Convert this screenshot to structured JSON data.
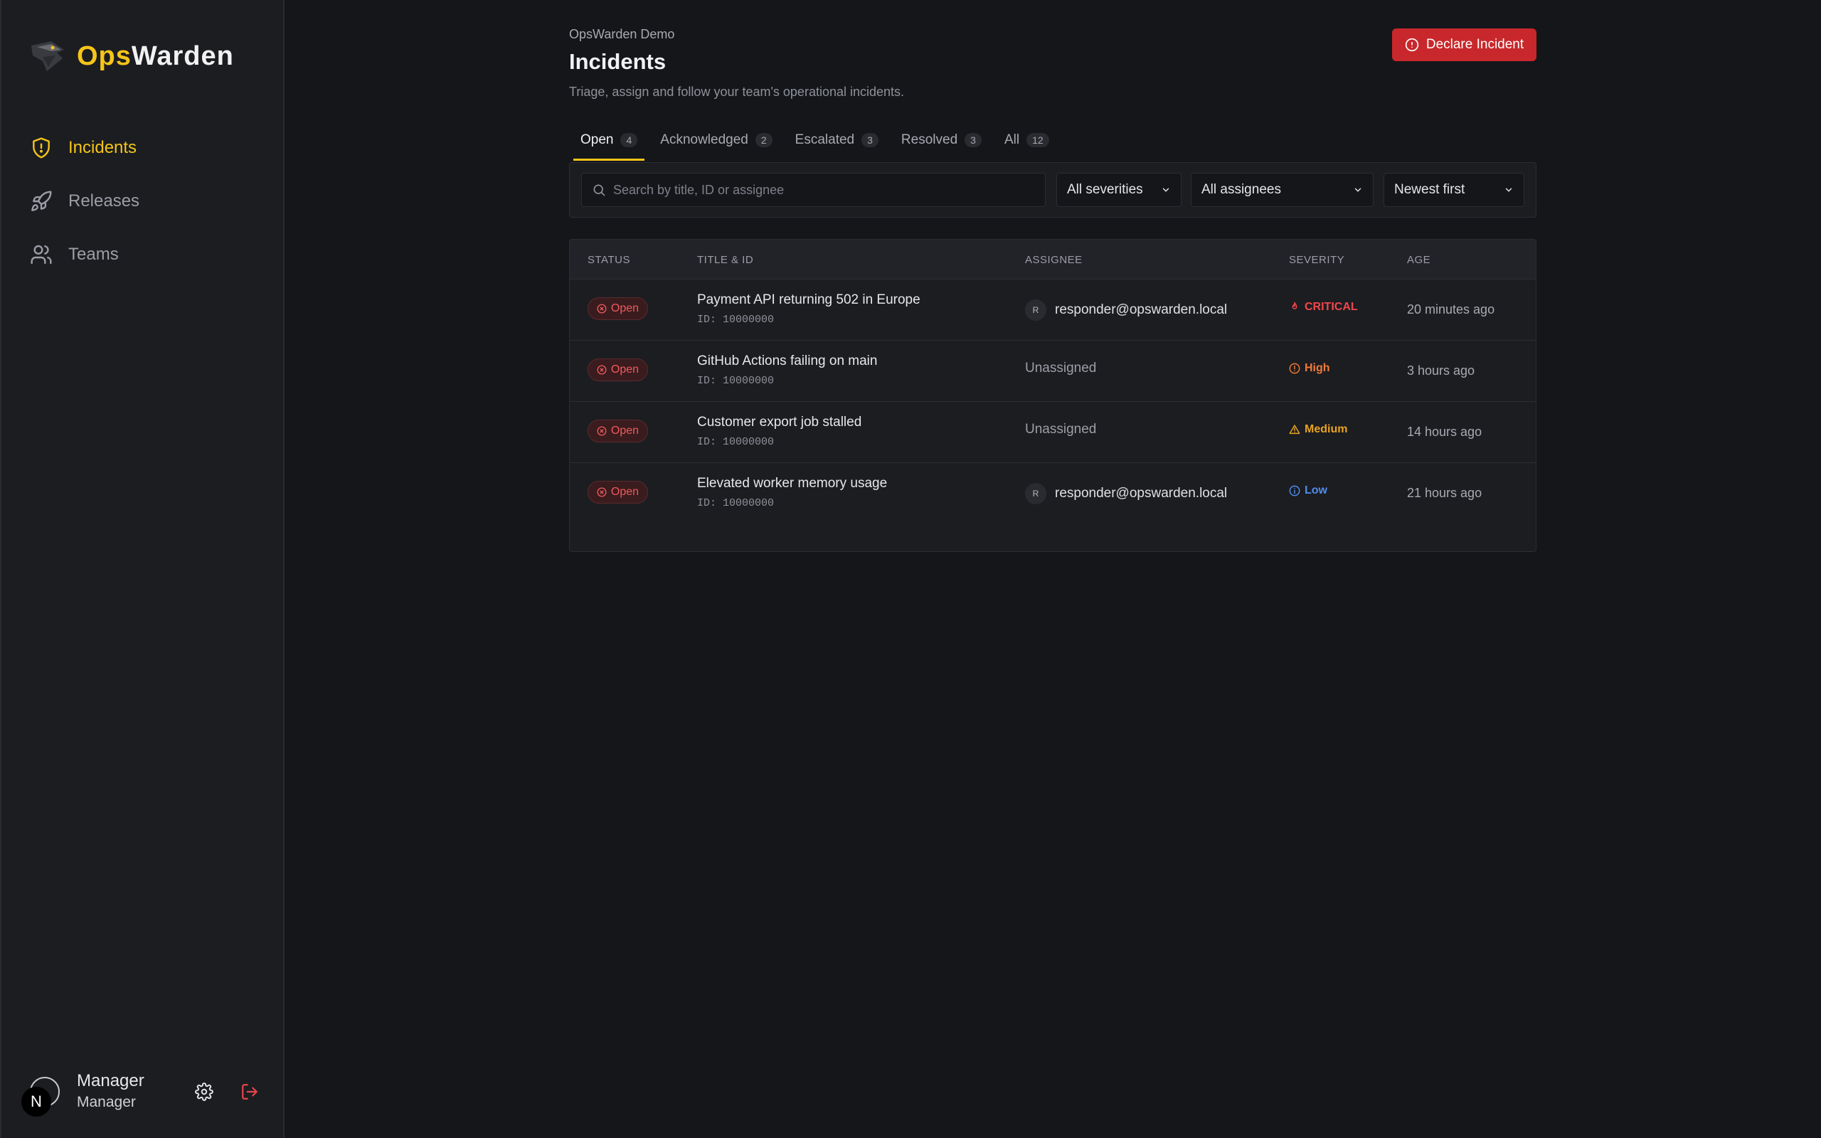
{
  "brand": {
    "prefix": "Ops",
    "suffix": "Warden"
  },
  "nav": [
    {
      "label": "Incidents",
      "icon": "shield-alert-icon",
      "active": true
    },
    {
      "label": "Releases",
      "icon": "rocket-icon",
      "active": false
    },
    {
      "label": "Teams",
      "icon": "users-icon",
      "active": false
    }
  ],
  "user": {
    "name": "Manager",
    "role": "Manager",
    "badge": "N"
  },
  "header": {
    "crumb": "OpsWarden Demo",
    "title": "Incidents",
    "subtitle": "Triage, assign and follow your team's operational incidents.",
    "declare_label": "Declare Incident"
  },
  "tabs": [
    {
      "label": "Open",
      "count": "4",
      "active": true
    },
    {
      "label": "Acknowledged",
      "count": "2",
      "active": false
    },
    {
      "label": "Escalated",
      "count": "3",
      "active": false
    },
    {
      "label": "Resolved",
      "count": "3",
      "active": false
    },
    {
      "label": "All",
      "count": "12",
      "active": false
    }
  ],
  "filters": {
    "search_placeholder": "Search by title, ID or assignee",
    "severity": "All severities",
    "assignee": "All assignees",
    "sort": "Newest first"
  },
  "table": {
    "columns": [
      "STATUS",
      "TITLE & ID",
      "ASSIGNEE",
      "SEVERITY",
      "AGE"
    ],
    "rows": [
      {
        "status": "Open",
        "title": "Payment API returning 502 in Europe",
        "id": "ID: 10000000",
        "assignee_initial": "R",
        "assignee": "responder@opswarden.local",
        "assigned": true,
        "severity": "CRITICAL",
        "severity_color": "#f0474b",
        "severity_icon": "flame-icon",
        "age": "20 minutes ago"
      },
      {
        "status": "Open",
        "title": "GitHub Actions failing on main",
        "id": "ID: 10000000",
        "assignee_initial": "",
        "assignee": "Unassigned",
        "assigned": false,
        "severity": "High",
        "severity_color": "#f07a3a",
        "severity_icon": "alert-circle-icon",
        "age": "3 hours ago"
      },
      {
        "status": "Open",
        "title": "Customer export job stalled",
        "id": "ID: 10000000",
        "assignee_initial": "",
        "assignee": "Unassigned",
        "assigned": false,
        "severity": "Medium",
        "severity_color": "#e8a320",
        "severity_icon": "warning-triangle-icon",
        "age": "14 hours ago"
      },
      {
        "status": "Open",
        "title": "Elevated worker memory usage",
        "id": "ID: 10000000",
        "assignee_initial": "R",
        "assignee": "responder@opswarden.local",
        "assigned": true,
        "severity": "Low",
        "severity_color": "#4f8ef0",
        "severity_icon": "info-icon",
        "age": "21 hours ago"
      }
    ]
  },
  "colors": {
    "accent": "#f5c518",
    "danger": "#c8282b"
  }
}
